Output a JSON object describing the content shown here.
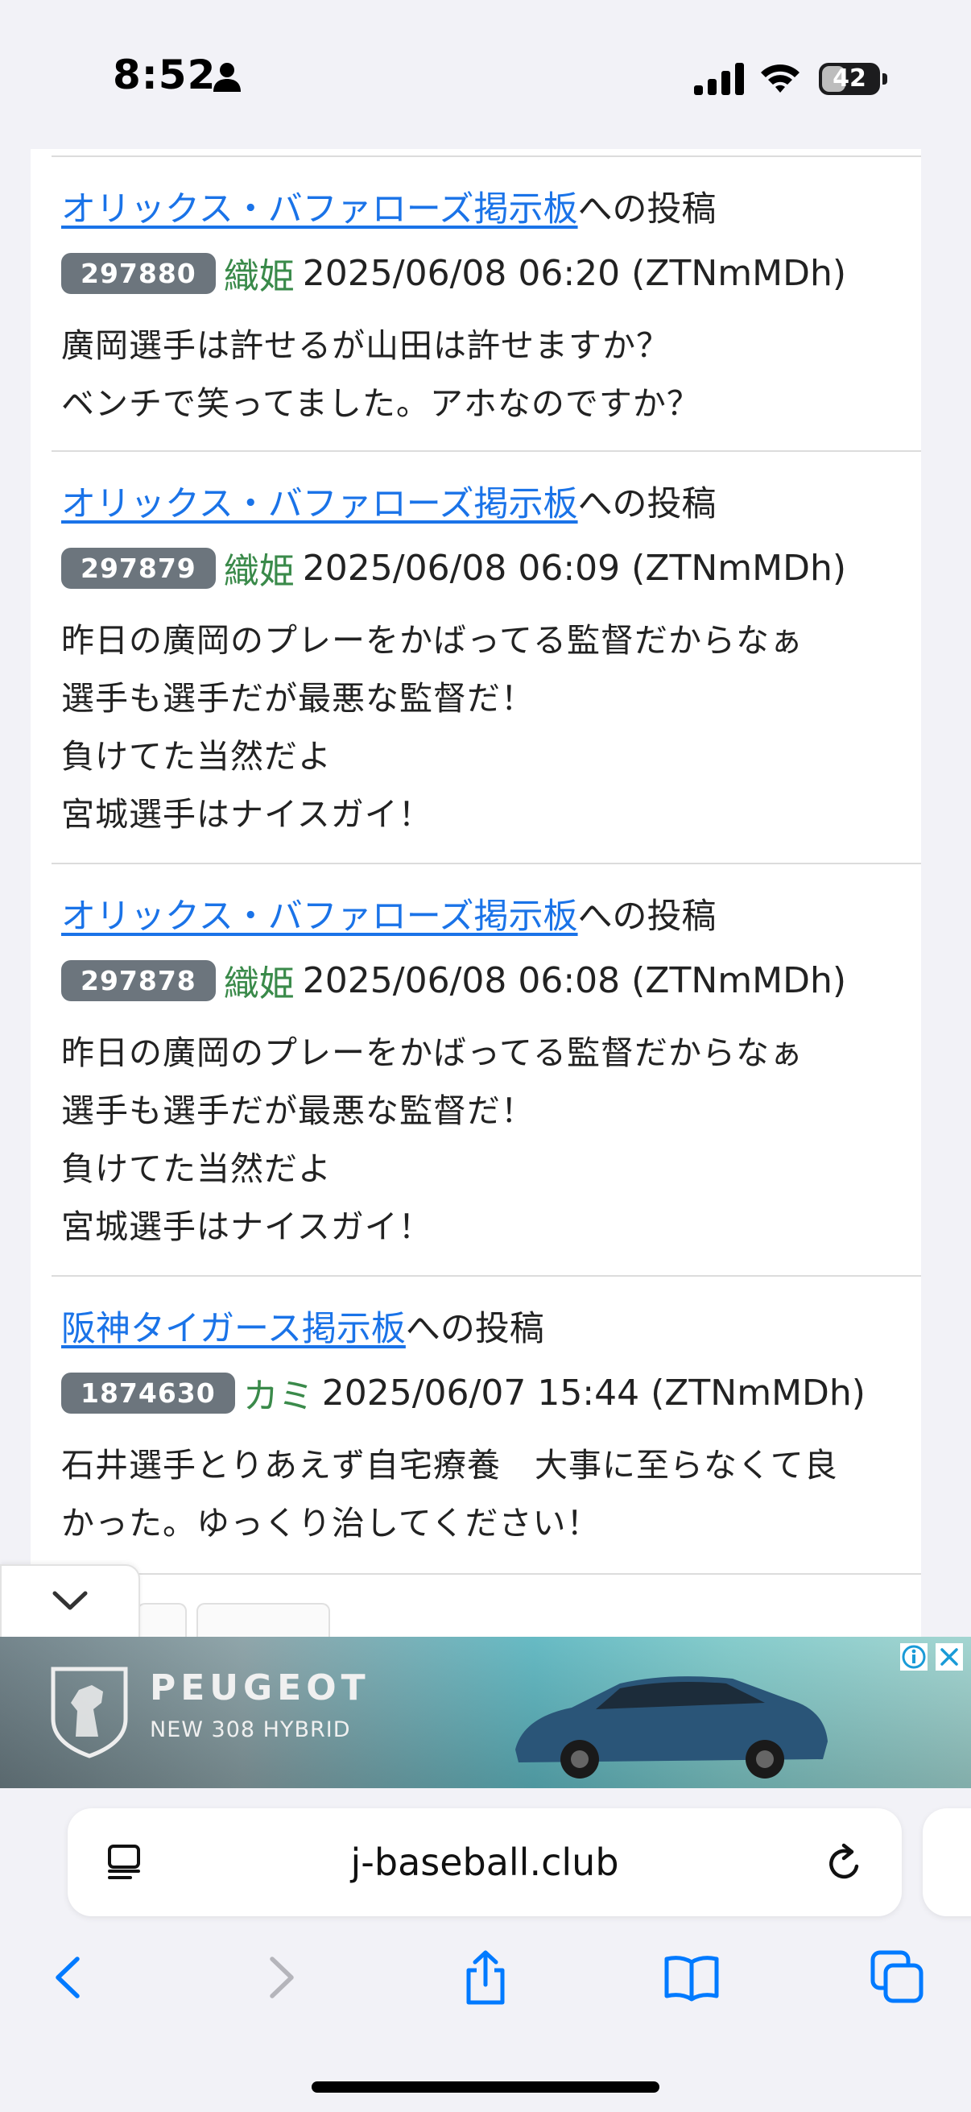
{
  "status_bar": {
    "time": "8:52",
    "battery_level": "42",
    "battery_fraction": 0.42
  },
  "posts": [
    {
      "board": "オリックス・バファローズ掲示板",
      "suffix": "への投稿",
      "id": "297880",
      "author": "織姫",
      "datetime": "2025/06/08 06:20 (ZTNmMDh)",
      "lines": [
        "廣岡選手は許せるが山田は許せますか？",
        "ベンチで笑ってました。アホなのですか？"
      ]
    },
    {
      "board": "オリックス・バファローズ掲示板",
      "suffix": "への投稿",
      "id": "297879",
      "author": "織姫",
      "datetime": "2025/06/08 06:09 (ZTNmMDh)",
      "lines": [
        "昨日の廣岡のプレーをかばってる監督だからなぁ",
        "選手も選手だが最悪な監督だ！",
        "負けてた当然だよ",
        "宮城選手はナイスガイ！"
      ]
    },
    {
      "board": "オリックス・バファローズ掲示板",
      "suffix": "への投稿",
      "id": "297878",
      "author": "織姫",
      "datetime": "2025/06/08 06:08 (ZTNmMDh)",
      "lines": [
        "昨日の廣岡のプレーをかばってる監督だからなぁ",
        "選手も選手だが最悪な監督だ！",
        "負けてた当然だよ",
        "宮城選手はナイスガイ！"
      ]
    },
    {
      "board": "阪神タイガース掲示板",
      "suffix": "への投稿",
      "id": "1874630",
      "author": "カミ",
      "datetime": "2025/06/07 15:44 (ZTNmMDh)",
      "lines": [
        "石井選手とりあえず自宅療養　大事に至らなくて良",
        "かった。ゆっくり治してください！"
      ]
    }
  ],
  "ad": {
    "brand": "PEUGEOT",
    "tagline": "NEW 308 HYBRID"
  },
  "browser": {
    "url": "j-baseball.club"
  },
  "colors": {
    "link": "#1a73e8",
    "author": "#3a8a4a",
    "badge": "#6c757d",
    "system_blue": "#007aff"
  }
}
